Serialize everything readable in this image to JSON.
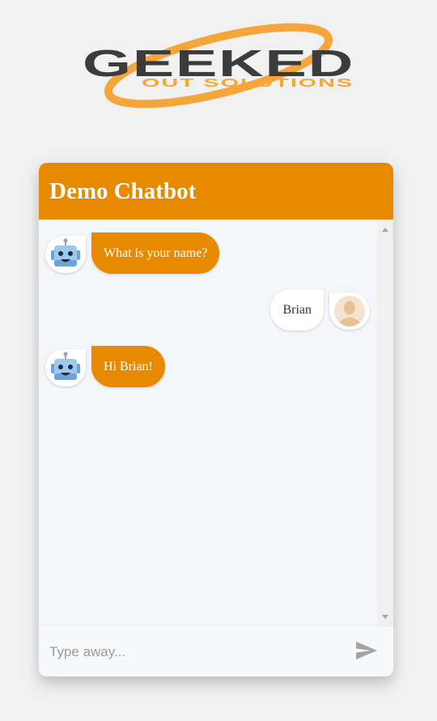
{
  "logo": {
    "brand_text": "GEEKED",
    "sub_text": "OUT SOLUTIONS"
  },
  "chat": {
    "title": "Demo Chatbot",
    "messages": [
      {
        "sender": "bot",
        "text": "What is your name?",
        "avatar_icon": "robot-icon"
      },
      {
        "sender": "user",
        "text": "Brian",
        "avatar_icon": "user-avatar-icon"
      },
      {
        "sender": "bot",
        "text": "Hi Brian!",
        "avatar_icon": "robot-icon"
      }
    ],
    "input_placeholder": "Type away...",
    "send_icon": "send-icon"
  },
  "colors": {
    "accent": "#e88a00",
    "logo_orange": "#f5a63a",
    "logo_dark": "#3c3c3c"
  }
}
